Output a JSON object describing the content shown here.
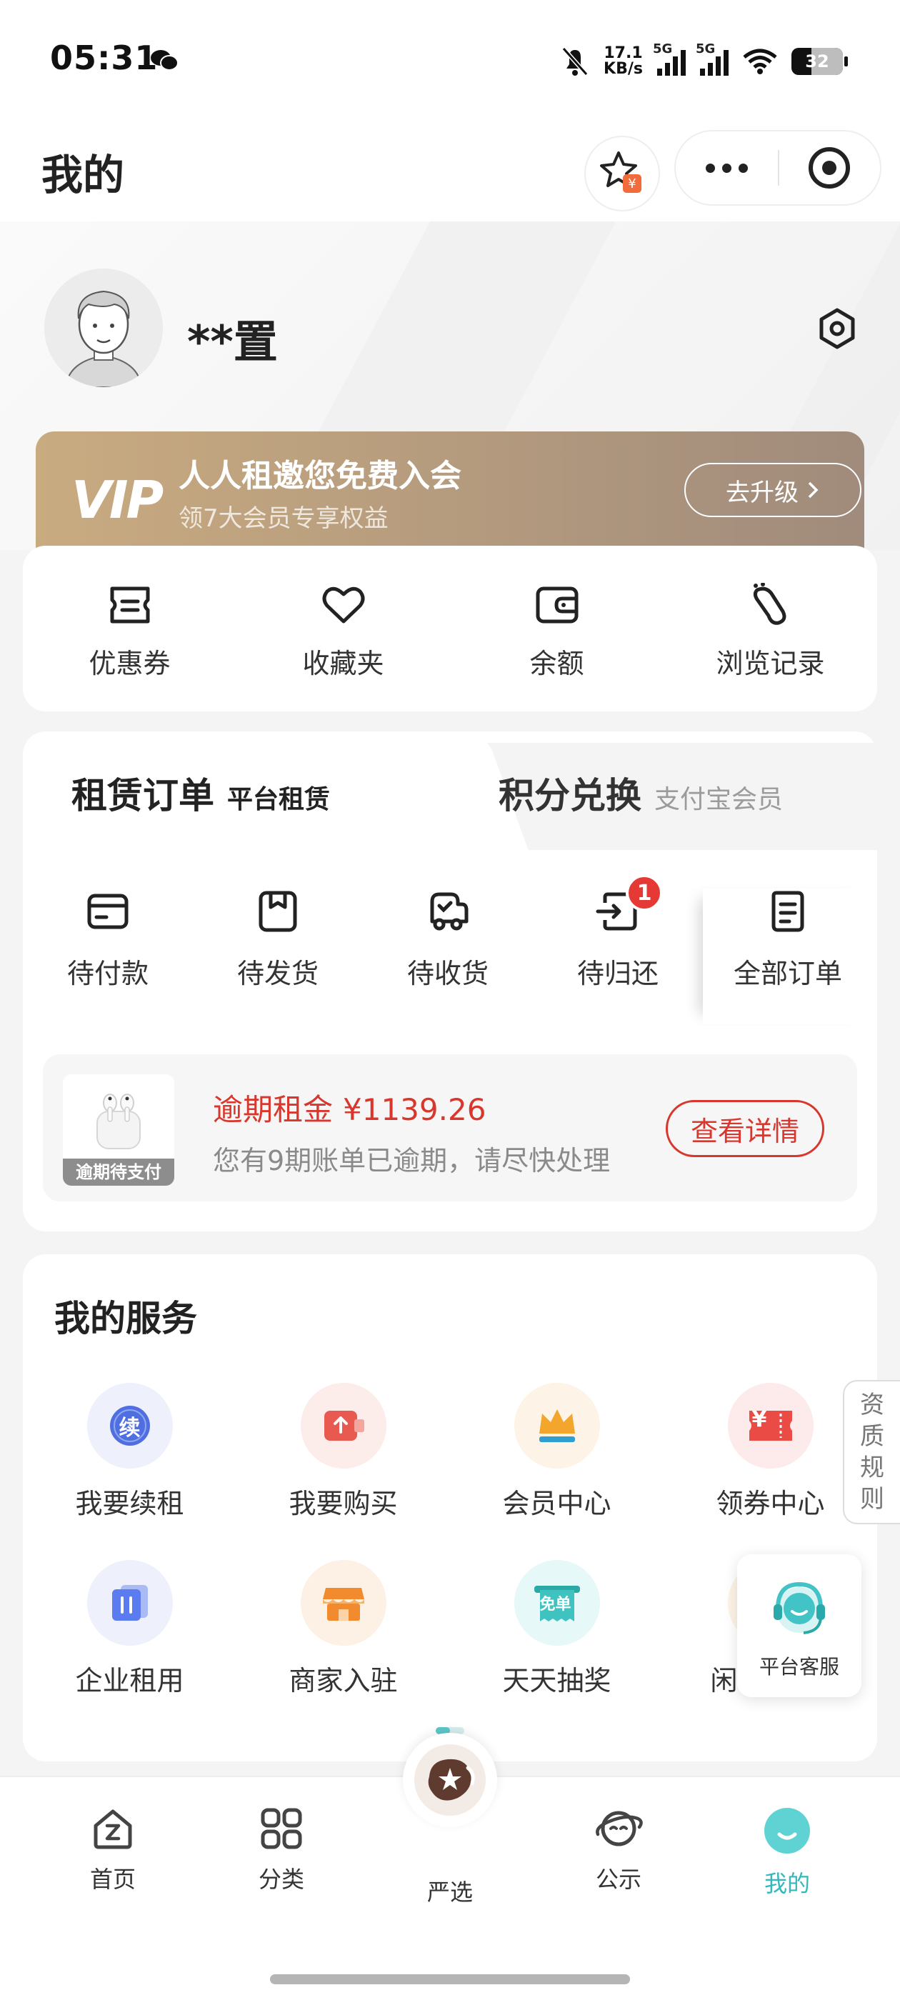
{
  "status_bar": {
    "time": "05:31",
    "net_speed_value": "17.1",
    "net_speed_unit": "KB/s",
    "signal1": "5G",
    "signal2": "5G",
    "battery": "32",
    "icons": [
      "wechat-icon",
      "mute-bell-icon",
      "signal-icon",
      "wifi-icon",
      "battery-icon"
    ]
  },
  "header": {
    "title": "我的",
    "icons": [
      "favorite-star-icon",
      "more-icon",
      "close-target-icon"
    ]
  },
  "profile": {
    "username": "**置",
    "vip": {
      "logo": "VIP",
      "title": "人人租邀您免费入会",
      "subtitle": "领7大会员专享权益",
      "button": "去升级"
    }
  },
  "quick_links": [
    {
      "label": "优惠券",
      "icon": "coupon-icon"
    },
    {
      "label": "收藏夹",
      "icon": "heart-icon"
    },
    {
      "label": "余额",
      "icon": "wallet-icon"
    },
    {
      "label": "浏览记录",
      "icon": "footprint-icon"
    }
  ],
  "orders": {
    "tab_active": {
      "title": "租赁订单",
      "subtitle": "平台租赁"
    },
    "tab_inactive": {
      "title": "积分兑换",
      "subtitle": "支付宝会员"
    },
    "statuses": [
      {
        "label": "待付款",
        "icon": "card-icon"
      },
      {
        "label": "待发货",
        "icon": "package-icon"
      },
      {
        "label": "待收货",
        "icon": "truck-icon"
      },
      {
        "label": "待归还",
        "icon": "return-icon",
        "badge": "1"
      },
      {
        "label": "全部订单",
        "icon": "list-icon"
      }
    ],
    "overdue": {
      "thumb_tag": "逾期待支付",
      "title": "逾期租金",
      "amount": "¥1139.26",
      "description": "您有9期账单已逾期，请尽快处理",
      "button": "查看详情"
    }
  },
  "services": {
    "title": "我的服务",
    "rows": [
      [
        {
          "label": "我要续租",
          "icon": "renew-icon",
          "glyph": "续",
          "color": "#4f6fe0"
        },
        {
          "label": "我要购买",
          "icon": "buy-icon",
          "color": "#e85a4f"
        },
        {
          "label": "会员中心",
          "icon": "crown-icon",
          "color": "#f4a52b"
        },
        {
          "label": "领券中心",
          "icon": "ticket-icon",
          "glyph": "¥",
          "color": "#ea4b45"
        }
      ],
      [
        {
          "label": "企业租用",
          "icon": "enterprise-icon",
          "color": "#5b7cf0"
        },
        {
          "label": "商家入驻",
          "icon": "shop-icon",
          "color": "#f28a2e"
        },
        {
          "label": "天天抽奖",
          "icon": "lottery-icon",
          "glyph": "免单",
          "color": "#3fc3c0"
        },
        {
          "label": "闲",
          "icon": "idle-icon",
          "color": "#f2b15a"
        }
      ]
    ]
  },
  "floating": {
    "rules": [
      "资",
      "质",
      "规",
      "则"
    ],
    "customer_service": "平台客服"
  },
  "tab_bar": [
    {
      "label": "首页",
      "icon": "home-icon"
    },
    {
      "label": "分类",
      "icon": "grid-icon"
    },
    {
      "label": "严选",
      "icon": "featured-icon"
    },
    {
      "label": "公示",
      "icon": "planet-icon"
    },
    {
      "label": "我的",
      "icon": "mine-icon",
      "active": true
    }
  ],
  "colors": {
    "accent": "#35b8bb",
    "danger": "#d8372e",
    "vip_gold": "#c9ab80"
  }
}
